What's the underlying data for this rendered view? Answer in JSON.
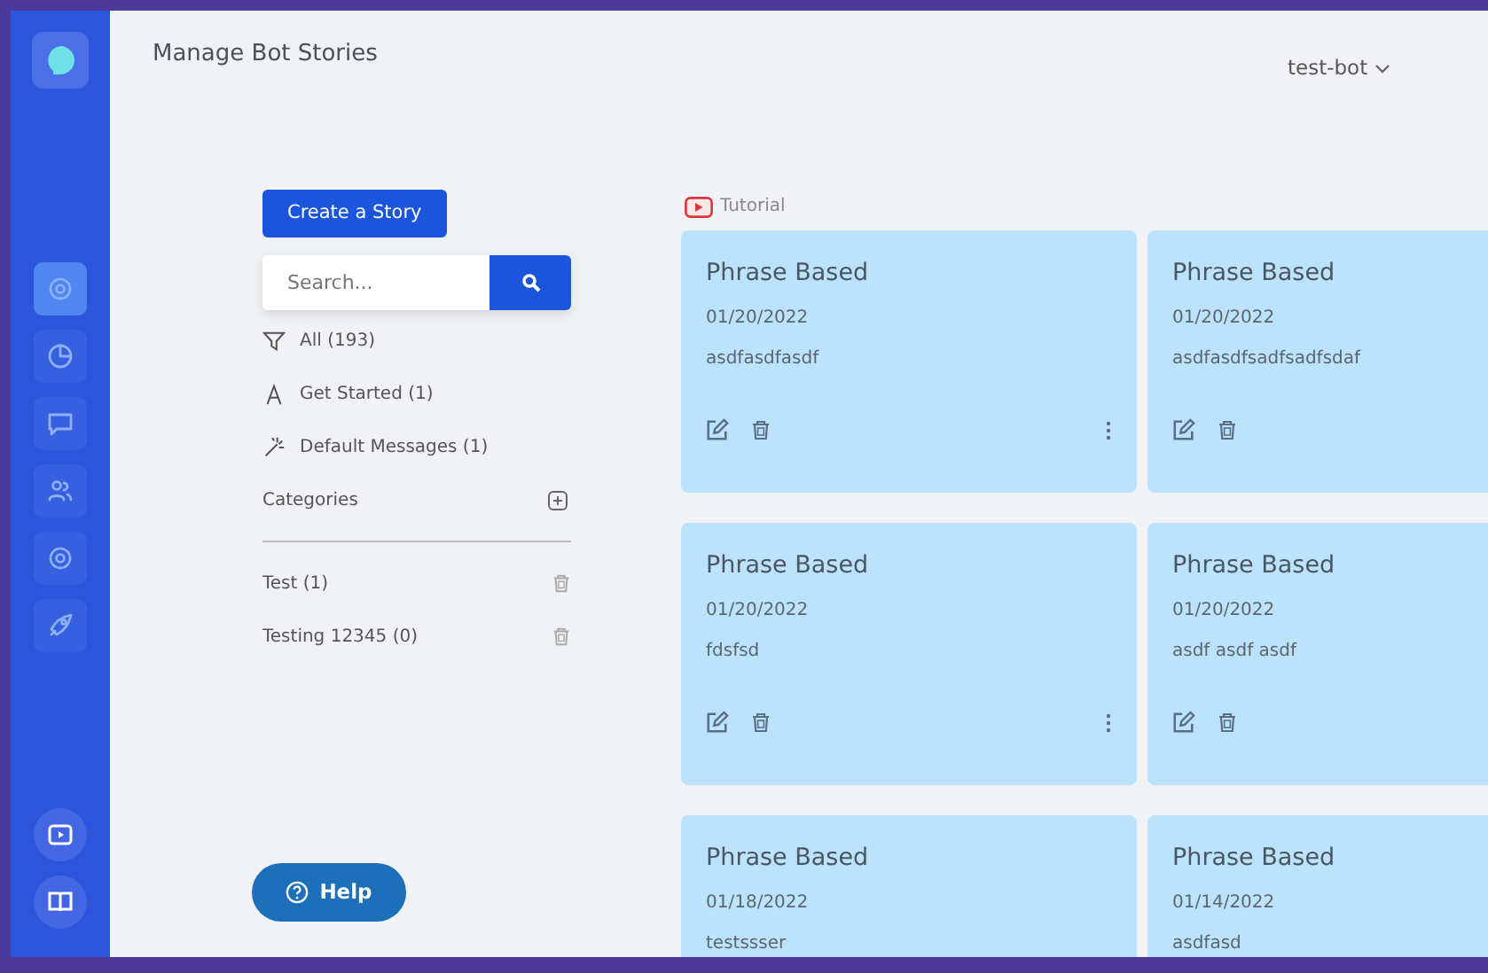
{
  "sidebar": {
    "top_items": [
      {
        "kind": "gear",
        "selected": true
      },
      {
        "kind": "pie",
        "selected": false
      },
      {
        "kind": "chat",
        "selected": false
      },
      {
        "kind": "people",
        "selected": false
      },
      {
        "kind": "gear",
        "selected": false
      },
      {
        "kind": "rocket",
        "selected": false
      }
    ],
    "bottom_items": [
      {
        "kind": "play",
        "selected": false
      },
      {
        "kind": "book",
        "selected": false
      }
    ]
  },
  "header": {
    "title": "Manage Bot Stories",
    "bot_selector": "test-bot"
  },
  "left_panel": {
    "create_button": "Create a Story",
    "search": {
      "placeholder": "Search..."
    },
    "filters": [
      {
        "kind": "filter",
        "label": "All (193)"
      },
      {
        "kind": "letter",
        "label": "Get Started (1)"
      },
      {
        "kind": "wand",
        "label": "Default Messages (1)"
      }
    ],
    "categories_label": "Categories",
    "categories": [
      {
        "label": "Test (1)"
      },
      {
        "label": "Testing 12345 (0)"
      }
    ],
    "help_button": "Help"
  },
  "tutorial_link": "Tutorial",
  "stories": [
    {
      "title": "Phrase Based",
      "date": "01/20/2022",
      "text": "asdfasdfasdf"
    },
    {
      "title": "Phrase Based",
      "date": "01/20/2022",
      "text": "asdfasdfsadfsadfsdaf"
    },
    {
      "title": "Phrase Based",
      "date": "01/20/2022",
      "text": "fdsfsd"
    },
    {
      "title": "Phrase Based",
      "date": "01/20/2022",
      "text": "asdf asdf asdf"
    },
    {
      "title": "Phrase Based",
      "date": "01/18/2022",
      "text": "testssser"
    },
    {
      "title": "Phrase Based",
      "date": "01/14/2022",
      "text": "asdfasd"
    }
  ]
}
